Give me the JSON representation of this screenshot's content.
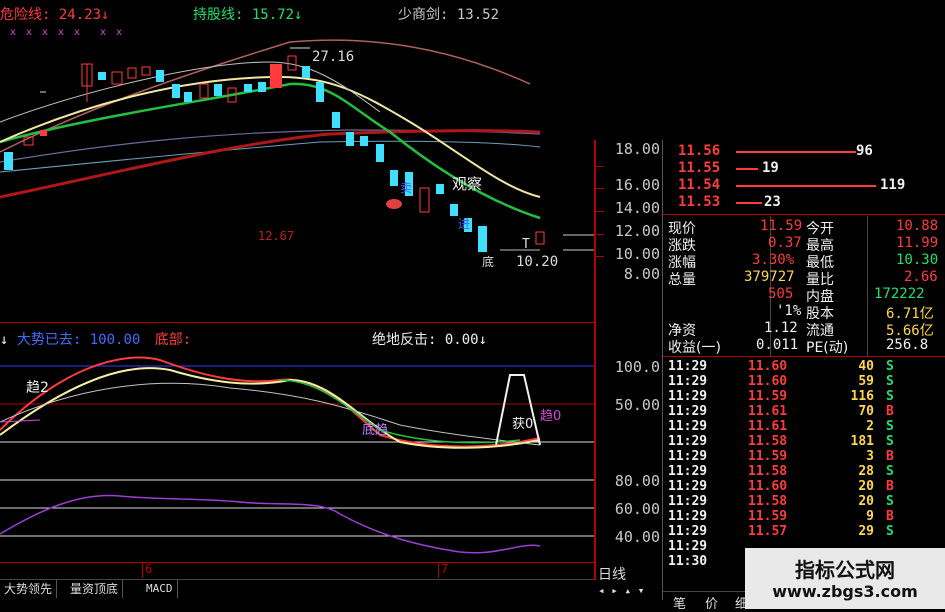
{
  "header": {
    "danger_label": "危险线:",
    "danger_value": "24.23",
    "danger_arrow": "↓",
    "hold_label": "持股线:",
    "hold_value": "15.72",
    "hold_arrow": "↓",
    "sword_label": "少商剑:",
    "sword_value": "13.52"
  },
  "main_chart": {
    "high_label": "27.16",
    "low_label": "10.20",
    "price_tag": "12.67",
    "observe_label": "观察",
    "bottom_marker": "底",
    "t_marker": "T",
    "sell_marker": "卖",
    "buy_marker": "进",
    "y_axis": [
      "16.00",
      "14.00",
      "12.00",
      "10.00",
      "8.00"
    ],
    "y_axis_top": "18.00"
  },
  "indicator_header": {
    "trend_label": "大势已去:",
    "trend_value": "100.00",
    "bottom_label": "底部:",
    "rebound_label": "绝地反击:",
    "rebound_value": "0.00",
    "arrow": "↓"
  },
  "indicator_chart": {
    "trend2_label": "趋2",
    "bottom_trend_label": "底趋",
    "buy_label": "获0",
    "trend0_label": "趋0",
    "y_axis": [
      "100.0",
      "50.00"
    ]
  },
  "lower_chart": {
    "y_axis": [
      "80.00",
      "60.00",
      "40.00"
    ]
  },
  "time_axis": {
    "label_6": "6",
    "label_7": "7"
  },
  "bottom_tabs": [
    "大势领先",
    "量资顶底",
    "MACD"
  ],
  "day_line_label": "日线",
  "orderbook": [
    {
      "price": "11.56",
      "vol": "96"
    },
    {
      "price": "11.55",
      "vol": "19"
    },
    {
      "price": "11.54",
      "vol": "119"
    },
    {
      "price": "11.53",
      "vol": "23"
    }
  ],
  "quote": [
    {
      "l1": "现价",
      "v1": "11.59",
      "l2": "今开",
      "v2": "10.88"
    },
    {
      "l1": "涨跌",
      "v1": "0.37",
      "l2": "最高",
      "v2": "11.99"
    },
    {
      "l1": "涨幅",
      "v1": "3.30%",
      "l2": "最低",
      "v2": "10.30"
    },
    {
      "l1": "总量",
      "v1": "379727",
      "l2": "量比",
      "v2": "2.66"
    },
    {
      "l1": "",
      "v1": "505",
      "l2": "内盘",
      "v2": "172222"
    },
    {
      "l1": "",
      "v1": "'1%",
      "l2": "股本",
      "v2": "6.71亿"
    },
    {
      "l1": "净资",
      "v1": "1.12",
      "l2": "流通",
      "v2": "5.66亿"
    },
    {
      "l1": "收益(一)",
      "v1": "0.011",
      "l2": "PE(动)",
      "v2": "256.8"
    }
  ],
  "ticks": [
    {
      "t": "11:29",
      "p": "11.60",
      "v": "40",
      "s": "S"
    },
    {
      "t": "11:29",
      "p": "11.60",
      "v": "59",
      "s": "S"
    },
    {
      "t": "11:29",
      "p": "11.59",
      "v": "116",
      "s": "S"
    },
    {
      "t": "11:29",
      "p": "11.61",
      "v": "70",
      "s": "B"
    },
    {
      "t": "11:29",
      "p": "11.61",
      "v": "2",
      "s": "S"
    },
    {
      "t": "11:29",
      "p": "11.58",
      "v": "181",
      "s": "S"
    },
    {
      "t": "11:29",
      "p": "11.59",
      "v": "3",
      "s": "B"
    },
    {
      "t": "11:29",
      "p": "11.58",
      "v": "28",
      "s": "S"
    },
    {
      "t": "11:29",
      "p": "11.60",
      "v": "20",
      "s": "B"
    },
    {
      "t": "11:29",
      "p": "11.58",
      "v": "20",
      "s": "S"
    },
    {
      "t": "11:29",
      "p": "11.59",
      "v": "9",
      "s": "B"
    },
    {
      "t": "11:29",
      "p": "11.57",
      "v": "29",
      "s": "S"
    },
    {
      "t": "11:29",
      "p": "",
      "v": "",
      "s": ""
    },
    {
      "t": "11:30",
      "p": "",
      "v": "",
      "s": ""
    }
  ],
  "bottom_right_tabs": [
    "笔",
    "价",
    "细"
  ],
  "watermark": {
    "title": "指标公式网",
    "url": "www.zbgs3.com"
  }
}
